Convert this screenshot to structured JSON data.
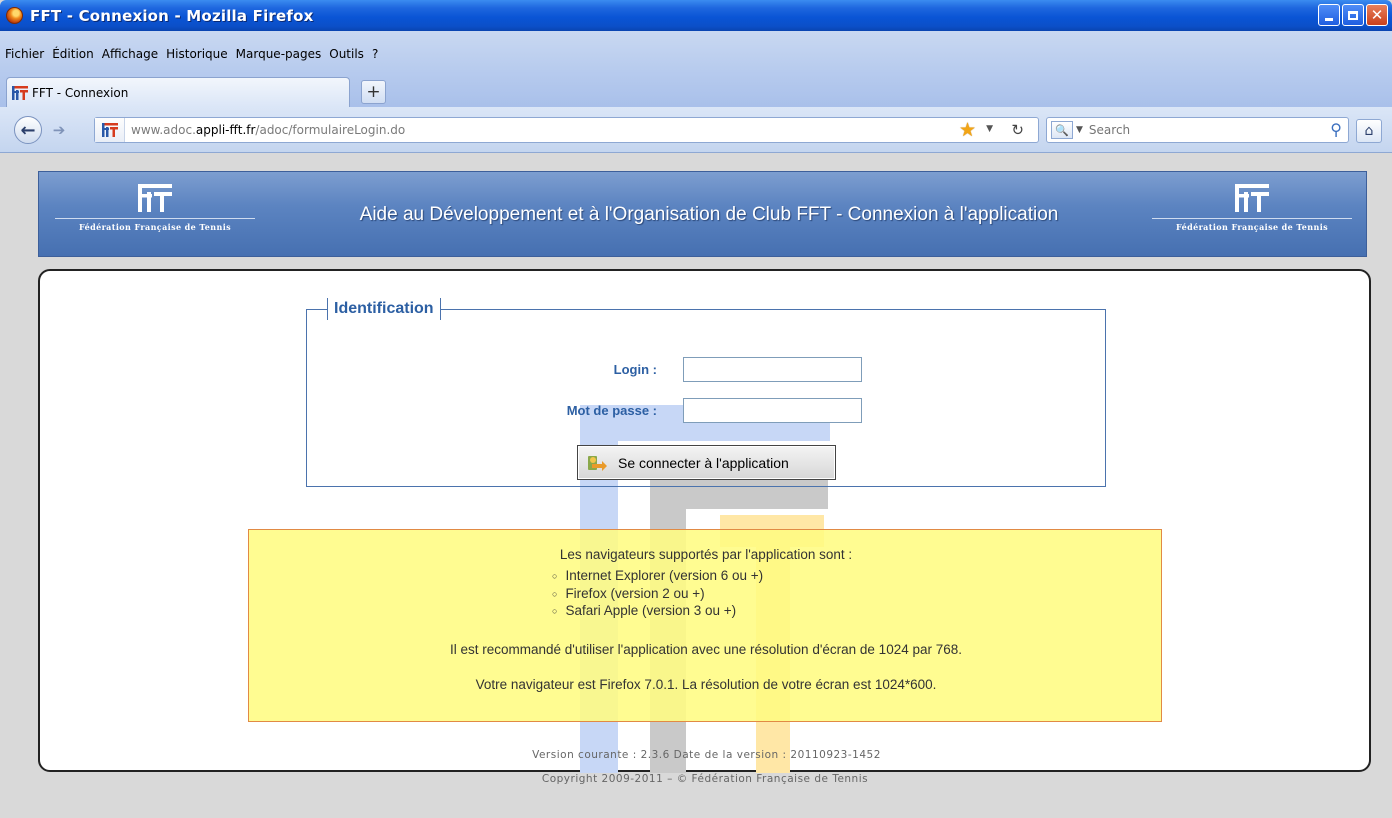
{
  "window": {
    "title": "FFT - Connexion - Mozilla Firefox",
    "icon": "firefox-icon"
  },
  "menu": [
    "Fichier",
    "Édition",
    "Affichage",
    "Historique",
    "Marque-pages",
    "Outils",
    "?"
  ],
  "tab": {
    "label": "FFT - Connexion",
    "new_tab": "+"
  },
  "navbar": {
    "url_prefix": "www.adoc.",
    "url_domain": "appli-fft.fr",
    "url_path": "/adoc/formulaireLogin.do",
    "search_placeholder": "Search"
  },
  "banner": {
    "title": "Aide au Développement et à l'Organisation de Club FFT - Connexion à l'application",
    "logo_text": "Fédération Française de Tennis"
  },
  "login_form": {
    "legend": "Identification",
    "login_label": "Login :",
    "login_value": "",
    "password_label": "Mot de passe :",
    "password_value": "",
    "submit_label": "Se connecter à l'application"
  },
  "info": {
    "intro": "Les navigateurs supportés par l'application sont :",
    "browsers": [
      "Internet Explorer (version 6 ou +)",
      "Firefox (version 2 ou +)",
      "Safari Apple (version 3 ou +)"
    ],
    "recommendation": "Il est recommandé d'utiliser l'application avec une résolution d'écran de 1024 par 768.",
    "detected": "Votre navigateur est Firefox 7.0.1. La résolution de votre écran est 1024*600."
  },
  "footer": {
    "version": "Version courante : 2.3.6 Date de la version : 20110923-1452",
    "copyright": "Copyright 2009-2011 – © Fédération Française de Tennis"
  },
  "colors": {
    "title_bar": "#0a55d6",
    "banner": "#5c84c1",
    "label_blue": "#2c5fa3",
    "info_bg": "#fffc82",
    "info_border": "#e18a44"
  }
}
